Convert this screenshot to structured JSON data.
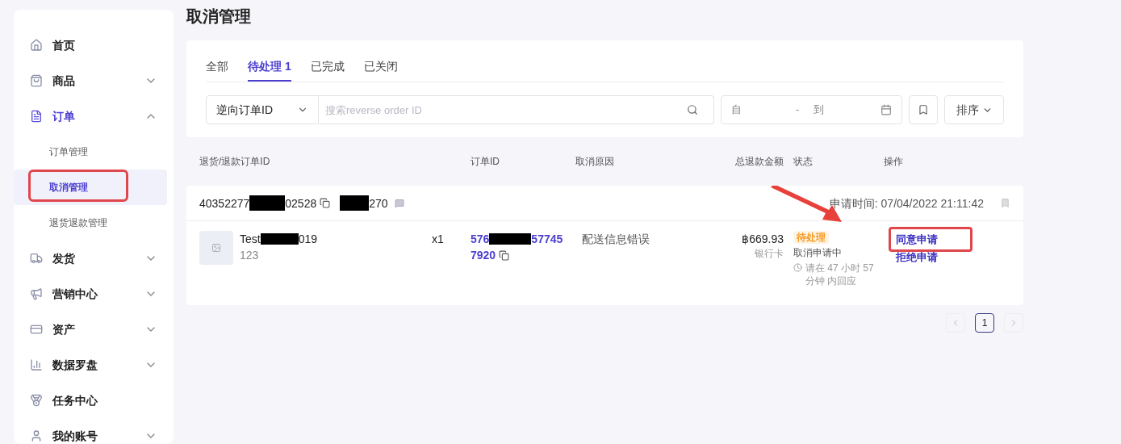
{
  "sidebar": {
    "items": [
      {
        "label": "首页",
        "expandable": false,
        "selected": false
      },
      {
        "label": "商品",
        "expandable": true,
        "expanded": false,
        "selected": false
      },
      {
        "label": "订单",
        "expandable": true,
        "expanded": true,
        "selected": true,
        "children": [
          {
            "label": "订单管理",
            "selected": false,
            "highlighted": false
          },
          {
            "label": "取消管理",
            "selected": true,
            "highlighted": true
          },
          {
            "label": "退货退款管理",
            "selected": false,
            "highlighted": false
          }
        ]
      },
      {
        "label": "发货",
        "expandable": true,
        "expanded": false,
        "selected": false
      },
      {
        "label": "营销中心",
        "expandable": true,
        "expanded": false,
        "selected": false
      },
      {
        "label": "资产",
        "expandable": true,
        "expanded": false,
        "selected": false
      },
      {
        "label": "数据罗盘",
        "expandable": true,
        "expanded": false,
        "selected": false
      },
      {
        "label": "任务中心",
        "expandable": false,
        "selected": false
      },
      {
        "label": "我的账号",
        "expandable": true,
        "expanded": false,
        "selected": false
      }
    ]
  },
  "page_title": "取消管理",
  "tabs": [
    {
      "label": "全部",
      "selected": false
    },
    {
      "label": "待处理",
      "count": "1",
      "selected": true
    },
    {
      "label": "已完成",
      "selected": false
    },
    {
      "label": "已关闭",
      "selected": false
    }
  ],
  "filters": {
    "search_type": "逆向订单ID",
    "search": {
      "placeholder": "搜索reverse order ID"
    },
    "date_from": {
      "placeholder": "自"
    },
    "date_separator": "-",
    "date_to": {
      "placeholder": "到"
    },
    "sort": "排序"
  },
  "table": {
    "columns": [
      "退货/退款订单ID",
      "订单ID",
      "取消原因",
      "总退款金额",
      "状态",
      "操作"
    ],
    "rows": [
      {
        "reverse_id_start": "40352277",
        "reverse_id_end": "02528",
        "buyer_end": "270",
        "apply_time": "申请时间: 07/04/2022 21:11:42",
        "product_name_start": "Test",
        "product_name_end": "019",
        "product_variant": "123",
        "quantity": "x1",
        "order_id_start": "576",
        "order_id_end": "57745",
        "order_id_line2": "7920",
        "reason": "配送信息错误",
        "amount": "฿669.93",
        "payment": "银行卡",
        "status": "待处理",
        "status_detail": "取消申请中",
        "deadline": "请在 47 小时 57 分钟 内回应",
        "actions": [
          {
            "label": "同意申请",
            "highlighted": true
          },
          {
            "label": "拒绝申请",
            "highlighted": false
          }
        ]
      }
    ]
  },
  "pagination": {
    "pages": [
      {
        "label": "1",
        "selected": true
      }
    ]
  }
}
